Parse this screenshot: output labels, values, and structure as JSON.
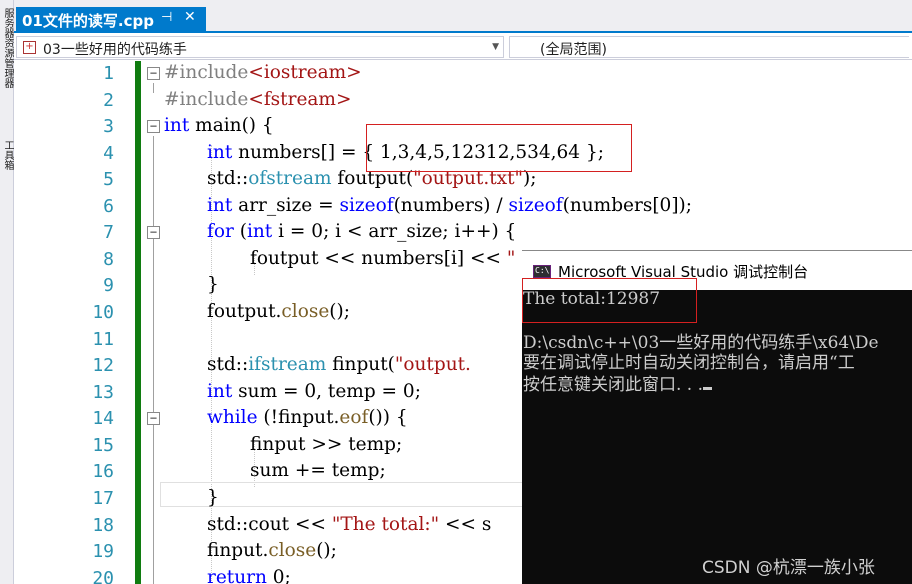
{
  "side_strip": {
    "labels": [
      "服务器资源管理器",
      "工具箱"
    ]
  },
  "tab": {
    "title": "01文件的读写.cpp",
    "pin_glyph": "⊣",
    "close_glyph": "✕"
  },
  "navbar": {
    "project": "03一些好用的代码练手",
    "scope": "(全局范围)"
  },
  "editor": {
    "line_numbers": [
      "1",
      "2",
      "3",
      "4",
      "5",
      "6",
      "7",
      "8",
      "9",
      "10",
      "11",
      "12",
      "13",
      "14",
      "15",
      "16",
      "17",
      "18",
      "19",
      "20"
    ],
    "code": {
      "l1_pp": "#include",
      "l1_inc": "<iostream>",
      "l2_pp": "#include",
      "l2_inc": "<fstream>",
      "l3_kw": "int",
      "l3_rest": " main() {",
      "l4_kw": "int",
      "l4_rest": " numbers[] = { 1,3,4,5,12312,534,64 };",
      "l5_a": "std::",
      "l5_cls": "ofstream",
      "l5_b": " foutput(",
      "l5_str": "\"output.txt\"",
      "l5_c": ");",
      "l6_kw": "int",
      "l6_a": " arr_size = ",
      "l6_kw2": "sizeof",
      "l6_b": "(numbers) / ",
      "l6_kw3": "sizeof",
      "l6_c": "(numbers[0]);",
      "l7_kw": "for",
      "l7_a": " (",
      "l7_kw2": "int",
      "l7_b": " i = 0; i < arr_size; i++) {",
      "l8_a": "foutput << numbers[i] << ",
      "l8_str": "\" \"",
      "l9": "}",
      "l10_a": "foutput.",
      "l10_fn": "close",
      "l10_b": "();",
      "l12_a": "std::",
      "l12_cls": "ifstream",
      "l12_b": " finput(",
      "l12_str": "\"output.",
      "l13_kw": "int",
      "l13_rest": " sum = 0, temp = 0;",
      "l14_kw": "while",
      "l14_a": " (!finput.",
      "l14_fn": "eof",
      "l14_b": "()) {",
      "l15": "finput >> temp;",
      "l16": "sum += temp;",
      "l17": "}",
      "l18_a": "std::cout << ",
      "l18_str": "\"The total:\"",
      "l18_b": " << s",
      "l19_a": "finput.",
      "l19_fn": "close",
      "l19_b": "();",
      "l20_kw": "return",
      "l20_rest": " 0;"
    },
    "fold_glyph": "−"
  },
  "console": {
    "title": "Microsoft Visual Studio 调试控制台",
    "icon_text": "C:\\",
    "lines": [
      "The total:12987",
      "",
      "D:\\csdn\\c++\\03一些好用的代码练手\\x64\\De",
      "要在调试停止时自动关闭控制台，请启用“工",
      "按任意键关闭此窗口. . ."
    ]
  },
  "watermark": "CSDN @杭漂一族小张",
  "colors": {
    "accent": "#007acc",
    "change_bar": "#107c10",
    "annotation": "#d42020",
    "console_bg": "#0c0c0c"
  }
}
